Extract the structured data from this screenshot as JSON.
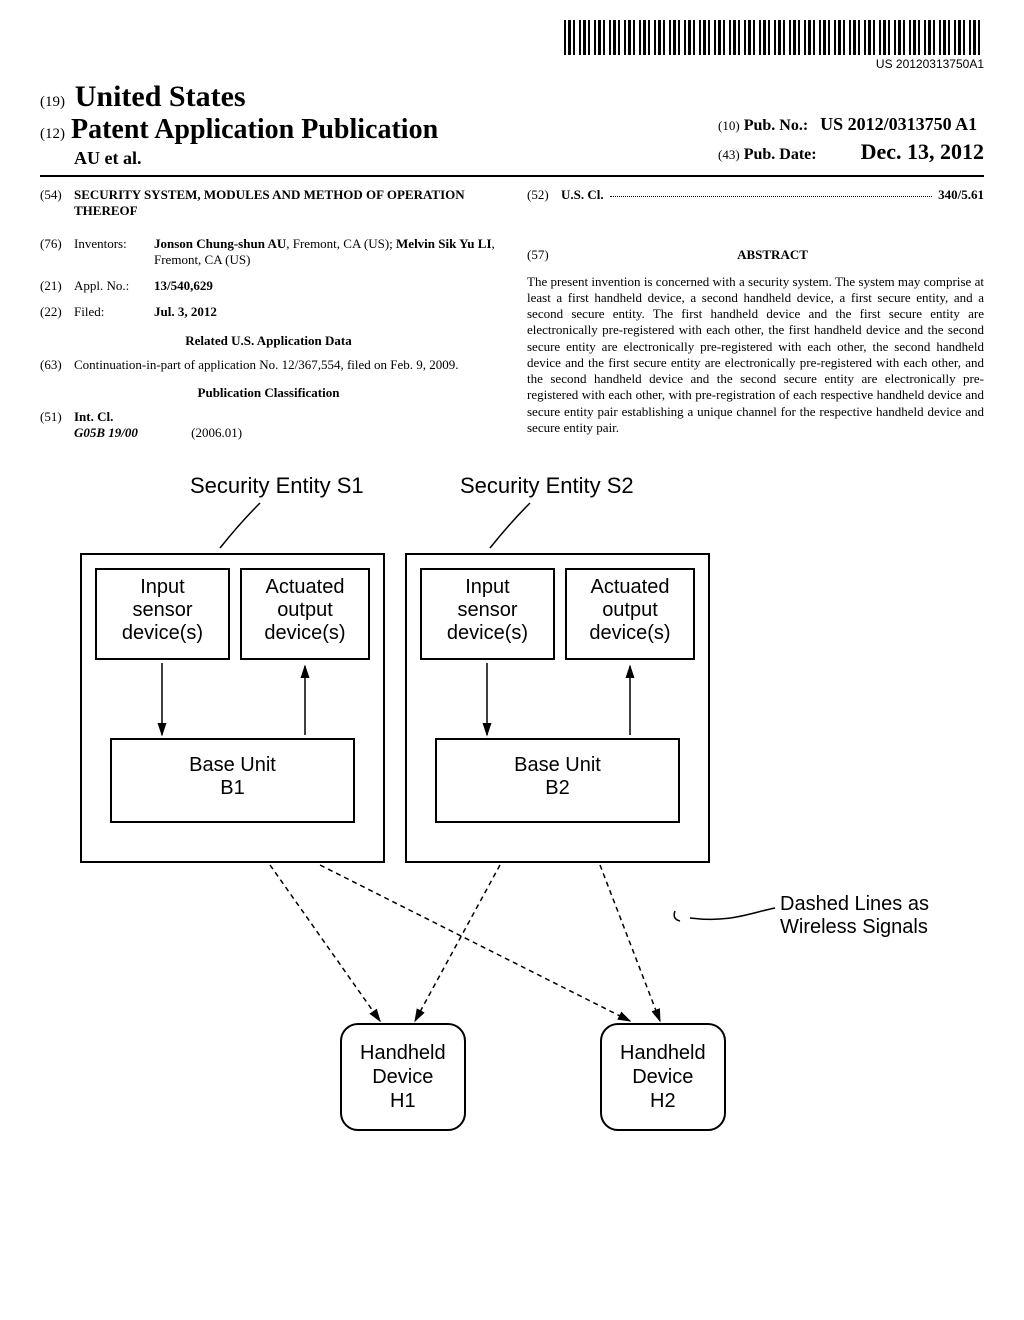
{
  "barcode_number": "US 20120313750A1",
  "header": {
    "num19": "(19)",
    "country": "United States",
    "num12": "(12)",
    "pubtype": "Patent Application Publication",
    "authors": "AU et al.",
    "num10": "(10)",
    "pubno_label": "Pub. No.:",
    "pubno_value": "US 2012/0313750 A1",
    "num43": "(43)",
    "pubdate_label": "Pub. Date:",
    "pubdate_value": "Dec. 13, 2012"
  },
  "bib": {
    "f54": {
      "num": "(54)",
      "value": "SECURITY SYSTEM, MODULES AND METHOD OF OPERATION THEREOF"
    },
    "f76": {
      "num": "(76)",
      "label": "Inventors:",
      "value_html": "Jonson Chung-shun AU, Fremont, CA (US); Melvin Sik Yu LI, Fremont, CA (US)",
      "inventor1_name": "Jonson Chung-shun AU",
      "inventor1_loc": ", Fremont, CA (US); ",
      "inventor2_name": "Melvin Sik Yu LI",
      "inventor2_loc": ", Fremont, CA (US)"
    },
    "f21": {
      "num": "(21)",
      "label": "Appl. No.:",
      "value": "13/540,629"
    },
    "f22": {
      "num": "(22)",
      "label": "Filed:",
      "value": "Jul. 3, 2012"
    },
    "related_heading": "Related U.S. Application Data",
    "f63": {
      "num": "(63)",
      "value": "Continuation-in-part of application No. 12/367,554, filed on Feb. 9, 2009."
    },
    "class_heading": "Publication Classification",
    "f51": {
      "num": "(51)",
      "label": "Int. Cl.",
      "code": "G05B 19/00",
      "edition": "(2006.01)"
    },
    "f52": {
      "num": "(52)",
      "label": "U.S. Cl.",
      "value": "340/5.61"
    },
    "f57": {
      "num": "(57)",
      "heading": "ABSTRACT"
    },
    "abstract": "The present invention is concerned with a security system. The system may comprise at least a first handheld device, a second handheld device, a first secure entity, and a second secure entity. The first handheld device and the first secure entity are electronically pre-registered with each other, the first handheld device and the second secure entity are electronically pre-registered with each other, the second handheld device and the first secure entity are electronically pre-registered with each other, and the second handheld device and the second secure entity are electronically pre-registered with each other, with pre-registration of each respective handheld device and secure entity pair establishing a unique channel for the respective handheld device and secure entity pair."
  },
  "figure": {
    "entity1_label": "Security Entity S1",
    "entity2_label": "Security Entity S2",
    "input_box": "Input\nsensor\ndevice(s)",
    "output_box": "Actuated\noutput\ndevice(s)",
    "base1": "Base Unit\nB1",
    "base2": "Base Unit\nB2",
    "handheld1": "Handheld\nDevice\nH1",
    "handheld2": "Handheld\nDevice\nH2",
    "wireless_label": "Dashed Lines as\nWireless Signals"
  }
}
